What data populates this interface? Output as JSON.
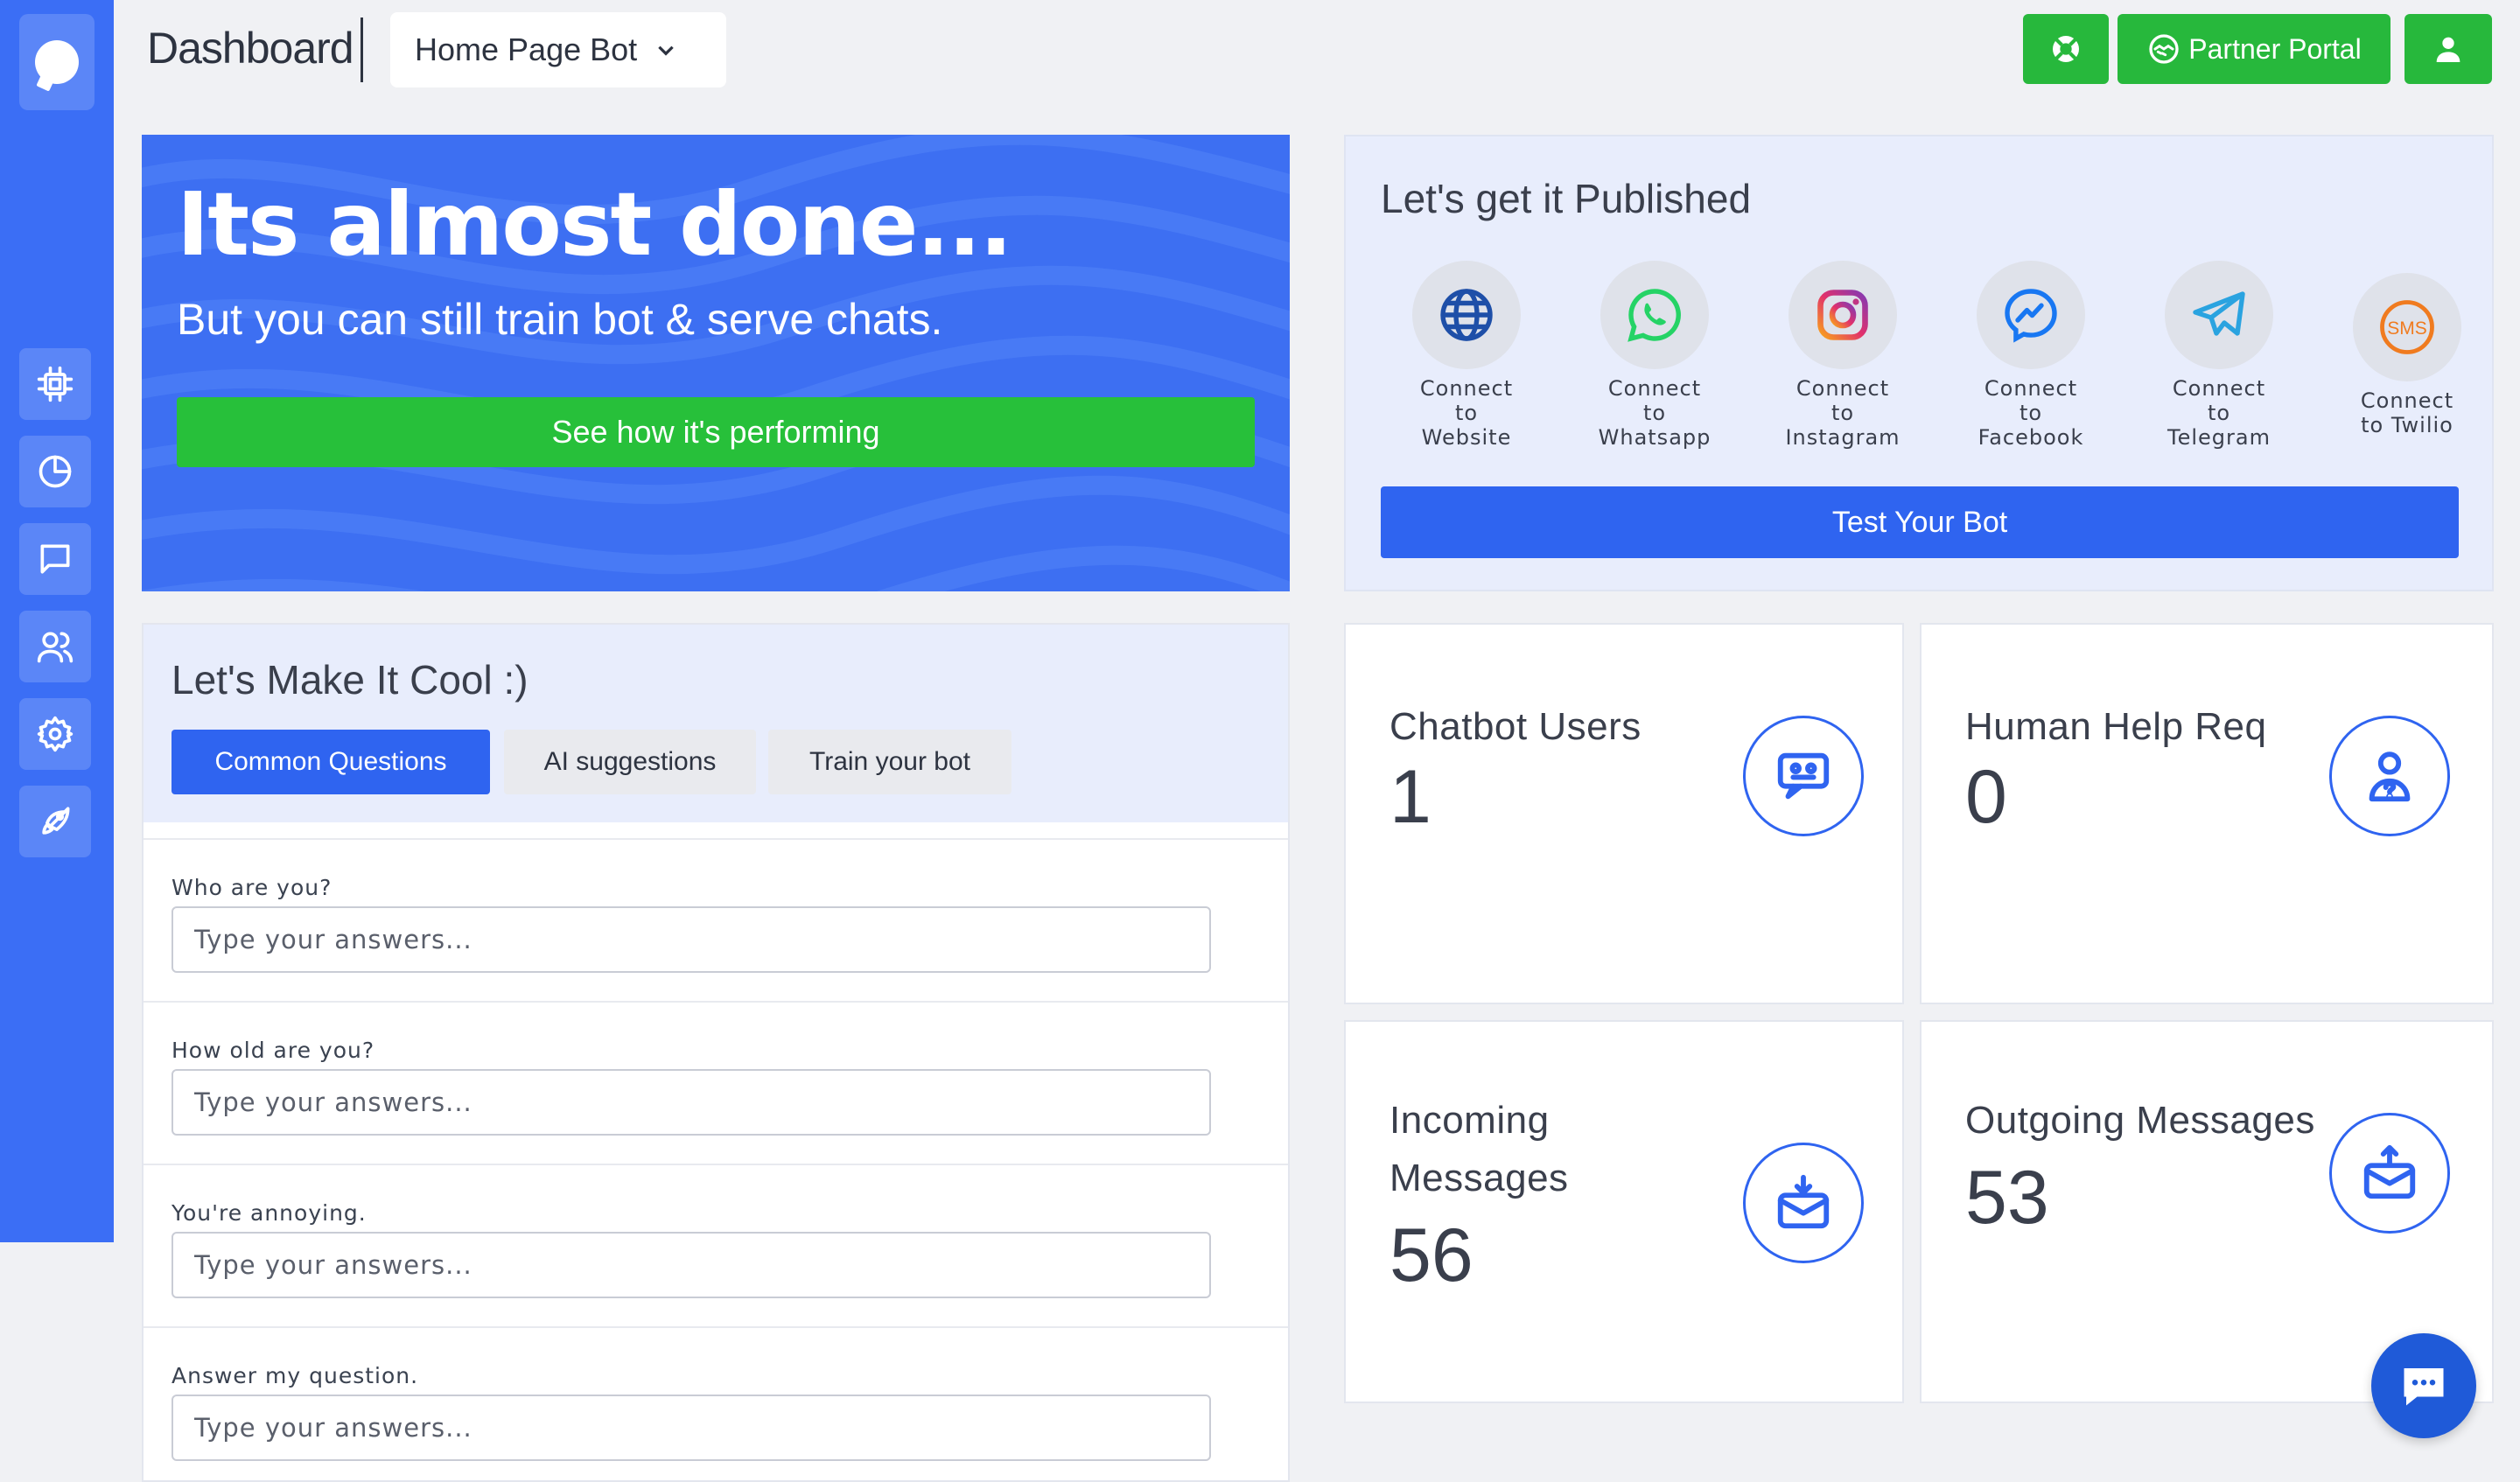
{
  "header": {
    "title": "Dashboard",
    "bot_selector": "Home Page Bot",
    "partner_portal": "Partner Portal"
  },
  "sidebar": {
    "items": [
      {
        "icon": "cpu-icon"
      },
      {
        "icon": "pie-chart-icon"
      },
      {
        "icon": "chat-icon"
      },
      {
        "icon": "users-icon"
      },
      {
        "icon": "gear-icon"
      },
      {
        "icon": "rocket-icon"
      }
    ]
  },
  "hero": {
    "title": "Its almost done...",
    "subtitle": "But you can still train bot & serve chats.",
    "button": "See how it's performing"
  },
  "publish": {
    "title": "Let's get it Published",
    "channels": [
      {
        "line1": "Connect",
        "line2": "to",
        "line3": "Website",
        "icon": "globe-icon"
      },
      {
        "line1": "Connect",
        "line2": "to",
        "line3": "Whatsapp",
        "icon": "whatsapp-icon"
      },
      {
        "line1": "Connect",
        "line2": "to",
        "line3": "Instagram",
        "icon": "instagram-icon"
      },
      {
        "line1": "Connect",
        "line2": "to",
        "line3": "Facebook",
        "icon": "messenger-icon"
      },
      {
        "line1": "Connect",
        "line2": "to",
        "line3": "Telegram",
        "icon": "telegram-icon"
      },
      {
        "line1": "Connect",
        "line2": "to Twilio",
        "line3": "",
        "icon": "sms-icon"
      }
    ],
    "test_button": "Test Your Bot"
  },
  "cool": {
    "title": "Let's Make It Cool :)",
    "tabs": [
      "Common Questions",
      "AI suggestions",
      "Train your bot"
    ],
    "questions": [
      {
        "q": "Who are you?",
        "placeholder": "Type your answers..."
      },
      {
        "q": "How old are you?",
        "placeholder": "Type your answers..."
      },
      {
        "q": "You're annoying.",
        "placeholder": "Type your answers..."
      },
      {
        "q": "Answer my question.",
        "placeholder": "Type your answers..."
      }
    ]
  },
  "stats": {
    "chatbot_users": {
      "label": "Chatbot Users",
      "value": "1"
    },
    "human_help": {
      "label": "Human Help Req",
      "value": "0"
    },
    "incoming": {
      "label_line1": "Incoming",
      "label_line2": "Messages",
      "value": "56"
    },
    "outgoing": {
      "label": "Outgoing Messages",
      "value": "53"
    }
  },
  "colors": {
    "primary": "#2f64f0",
    "sidebar": "#3b6ef5",
    "success": "#27b83c"
  }
}
